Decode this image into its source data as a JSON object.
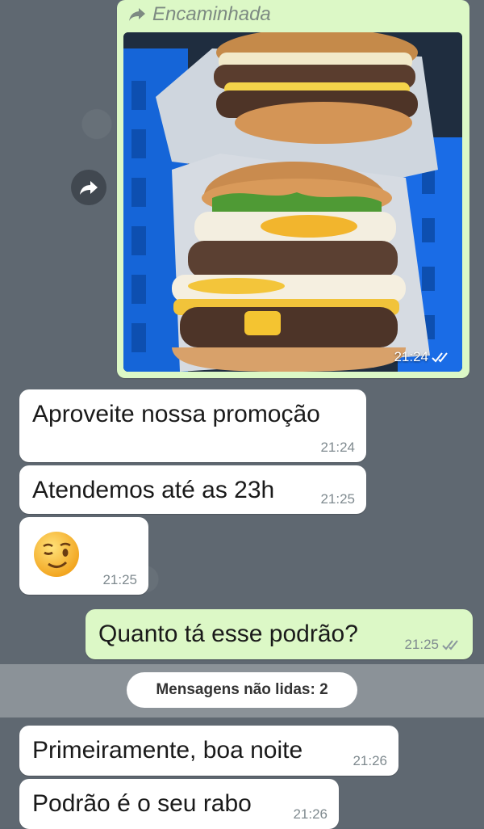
{
  "forwarded": {
    "label": "Encaminhada",
    "time": "21:24"
  },
  "messages": [
    {
      "text": "Aproveite nossa promoção",
      "time": "21:24"
    },
    {
      "text": "Atendemos até as 23h",
      "time": "21:25"
    },
    {
      "emoji": "winking-smile",
      "time": "21:25"
    },
    {
      "text": "Quanto tá esse podrão?",
      "time": "21:25"
    },
    {
      "text": "Primeiramente, boa noite",
      "time": "21:26"
    },
    {
      "text": "Podrão é o seu rabo",
      "time": "21:26"
    }
  ],
  "unread": {
    "label": "Mensagens não lidas: 2"
  },
  "colors": {
    "incoming": "#ffffff",
    "outgoing": "#dcf8c6",
    "background": "#5f6871"
  }
}
